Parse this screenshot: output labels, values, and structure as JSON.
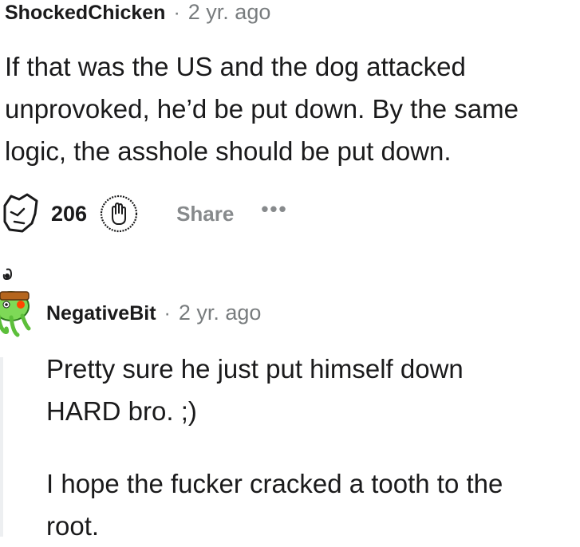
{
  "comments": [
    {
      "username": "ShockedChicken",
      "separator": "·",
      "age": "2 yr. ago",
      "body": [
        "If that was the US and the dog attacked",
        "unprovoked, he’d be put down. By the same",
        "logic, the asshole should be put down."
      ],
      "actions": {
        "votes": "206",
        "share_label": "Share",
        "more_label": "•••"
      }
    },
    {
      "username": "NegativeBit",
      "separator": "·",
      "age": "2 yr. ago",
      "body": [
        "Pretty sure he just put himself down",
        "HARD bro. ;)",
        "I hope the fucker cracked a tooth to the",
        "root."
      ]
    }
  ],
  "icons": {
    "upvote": "upvote-arrow-icon",
    "award": "award-hand-icon",
    "avatar": "snoo-avatar-icon"
  }
}
